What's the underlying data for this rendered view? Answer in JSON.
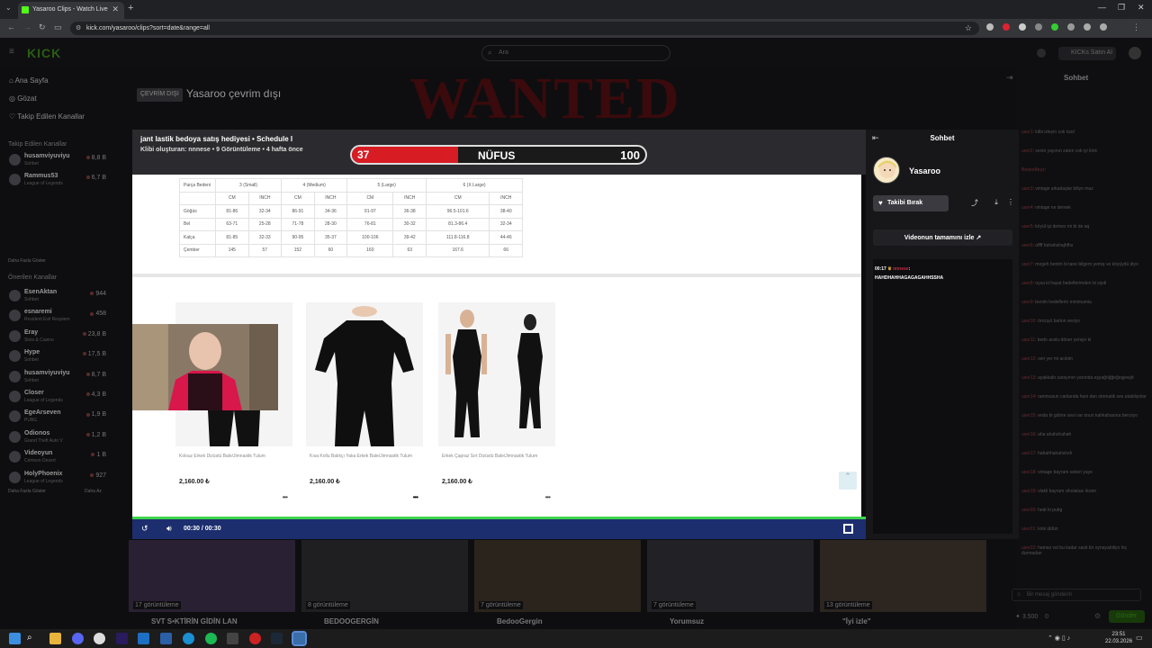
{
  "browser": {
    "tab_title": "Yasaroo Clips - Watch Live",
    "url": "kick.com/yasaroo/clips?sort=date&range=all"
  },
  "kick": {
    "logo": "KICK",
    "search_placeholder": "Ara",
    "buy_button": "KICKs Satın Al",
    "nav": [
      {
        "label": "Ana Sayfa"
      },
      {
        "label": "Gözat"
      },
      {
        "label": "Takip Edilen Kanallar"
      }
    ],
    "followed_header": "Takip Edilen Kanallar",
    "followed": [
      {
        "name": "husamviyuviyu",
        "game": "Sohbet",
        "viewers": "8,8 B"
      },
      {
        "name": "Rammus53",
        "game": "League of Legends",
        "viewers": "6,7 B"
      }
    ],
    "show_more_1": "Daha Fazla Göster",
    "suggested_header": "Önerilen Kanallar",
    "suggested": [
      {
        "name": "EsenAktan",
        "game": "Sohbet",
        "viewers": "944"
      },
      {
        "name": "esnaremi",
        "game": "Resident Evil Requiem",
        "viewers": "458"
      },
      {
        "name": "Eray",
        "game": "Slots & Casino",
        "viewers": "23,8 B"
      },
      {
        "name": "Hype",
        "game": "Sohbet",
        "viewers": "17,5 B"
      },
      {
        "name": "husamviyuviyu",
        "game": "Sohbet",
        "viewers": "8,7 B"
      },
      {
        "name": "Closer",
        "game": "League of Legends",
        "viewers": "4,3 B"
      },
      {
        "name": "EgeArseven",
        "game": "PUBG",
        "viewers": "1,9 B"
      },
      {
        "name": "Odionos",
        "game": "Grand Theft Auto V",
        "viewers": "1,2 B"
      },
      {
        "name": "Videoyun",
        "game": "Crimson Desert",
        "viewers": "1 B"
      },
      {
        "name": "HolyPhoenix",
        "game": "League of Legends",
        "viewers": "927"
      }
    ],
    "show_more_2": "Daha Fazla Göster",
    "show_less": "Daha Az",
    "offline_badge": "ÇEVRİM DIŞI",
    "offline_title": "Yasaroo çevrim dışı",
    "banner_text": "WANTED",
    "right_chat_title": "Sohbet",
    "right_chat": [
      {
        "user": "user1",
        "text": "kilbi izleyin cok özel"
      },
      {
        "user": "user2",
        "text": "senin yayının zaten cok iyi kink"
      },
      {
        "user": "BedooBeyz",
        "text": ""
      },
      {
        "user": "user3",
        "text": "vintage arkadaşlar biliyo muz"
      },
      {
        "user": "user4",
        "text": "vintage ne demek"
      },
      {
        "user": "user5",
        "text": "köyül işi demez mi bi de aq"
      },
      {
        "user": "user6",
        "text": "offff hahahshajhfhs"
      },
      {
        "user": "user7",
        "text": "mogeh benim bi tane bilgem yemiş ve köyüydü diyo"
      },
      {
        "user": "user8",
        "text": "oysa ki hayat hedeflerimden bi siydi"
      },
      {
        "user": "user9",
        "text": "benim hedeflerin minimumia"
      },
      {
        "user": "user10",
        "text": "öncüyü barkın seviyo"
      },
      {
        "user": "user11",
        "text": "bedo acelu döner yeniyo ki"
      },
      {
        "user": "user12",
        "text": "sen yer mi acıkim"
      },
      {
        "user": "user13",
        "text": "ayakkabı sarayının yanında eşyağöğğeğeşjewjd"
      },
      {
        "user": "user14",
        "text": "rammusun canlanda hani dan otomatik ses atabiliyolar"
      },
      {
        "user": "user15",
        "text": "enda bi gülme sesi var onun kahkahasına benziyo"
      },
      {
        "user": "user16",
        "text": "aha ahahshahah"
      },
      {
        "user": "user17",
        "text": "hahahhahahshsh"
      },
      {
        "user": "user18",
        "text": "vintage bayram sekeri yaye"
      },
      {
        "user": "user19",
        "text": "vlakli bayram cikolatası ikram"
      },
      {
        "user": "user20",
        "text": "hedi bi pubg"
      },
      {
        "user": "user21",
        "text": "kink üldün"
      },
      {
        "user": "user22",
        "text": "hamas vst bu kadar sasit bir oynayabiliyo hiç durmadan"
      }
    ],
    "chat_placeholder": "Bir mesaj gönderin",
    "points": "3.500",
    "points2": "0",
    "send_button": "Gönder",
    "clips": [
      {
        "views": "17 görüntüleme",
        "title": "SVT S•KTİRİN GİDİN LAN"
      },
      {
        "views": "8 görüntüleme",
        "title": "BEDOOGERGİN"
      },
      {
        "views": "7 görüntüleme",
        "title": "BedooGergin"
      },
      {
        "views": "7 görüntüleme",
        "title": "Yorumsuz"
      },
      {
        "views": "13 görüntüleme",
        "title": "\"İyi izle\""
      }
    ]
  },
  "clip_modal": {
    "title": "jant lastik bedoya satış hediyesi • Schedule I",
    "subtitle": "Klibi oluşturan: nnnese • 9 Görüntüleme • 4 hafta önce",
    "hud": {
      "left_value": "37",
      "title": "NÜFUS",
      "right_value": "100"
    },
    "size_table": {
      "header": [
        "Parça Bedeni",
        "3 (Small)",
        "4 (Medium)",
        "5 (Large)",
        "6 (X Large)"
      ],
      "units": [
        "",
        "CM",
        "INCH",
        "CM",
        "INCH",
        "CM",
        "INCH",
        "CM",
        "INCH"
      ],
      "rows": [
        [
          "Göğüs",
          "81-86",
          "32-34",
          "86-91",
          "34-36",
          "91-97",
          "36-38",
          "96.5-101.6",
          "38-40"
        ],
        [
          "Bel",
          "63-71",
          "25-28",
          "71-78",
          "28-30",
          "76-81",
          "30-32",
          "81.3-86.4",
          "32-34"
        ],
        [
          "Kalça",
          "81-85",
          "32-33",
          "90-95",
          "35-37",
          "100-106",
          "39-42",
          "111.8-116.8",
          "44-46"
        ],
        [
          "Çember",
          "145",
          "57",
          "152",
          "60",
          "160",
          "63",
          "167.6",
          "66"
        ]
      ]
    },
    "products": [
      {
        "name": "Kolsuz Erkek Dizüstü Bale/Jimnastik Tulum",
        "price": "2,160.00 ₺"
      },
      {
        "name": "Kısa Kollu Balıkçı Yaka Erkek Bale/Jimnastik Tulum",
        "price": "2,160.00 ₺"
      },
      {
        "name": "Erkek Çapraz Sırt Dizüstü Bale/Jimnastik Tulum",
        "price": "2,160.00 ₺"
      }
    ],
    "time": "00:30 / 00:30",
    "panel_title": "Sohbet",
    "streamer": "Yasaroo",
    "unfollow": "Takibi Bırak",
    "watch_full": "Videonun tamamını izle",
    "chat": {
      "time": "00:17",
      "user": "nnnese",
      "text": "HAHDHAHHAGAGAGAHHSSHA"
    }
  },
  "taskbar": {
    "time": "23:51",
    "date": "22.03.2026"
  }
}
